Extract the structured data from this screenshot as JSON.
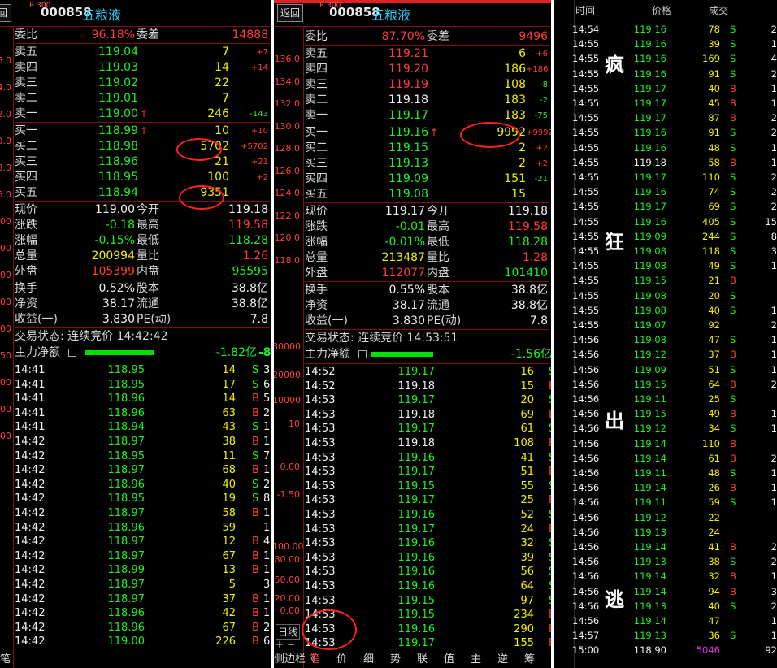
{
  "panel1": {
    "back": "回",
    "code": "000858",
    "name": "五粮液",
    "index_badge": "R 300",
    "weibi": {
      "label": "委比",
      "value": "96.18%",
      "diff_label": "委差",
      "diff": "14888"
    },
    "axis": [
      "6.0",
      "4.0",
      "2.0",
      "0.0",
      "8.0",
      "6.0",
      "00",
      "00",
      "00",
      "00",
      ".00",
      ".50",
      "00",
      "00",
      "00"
    ],
    "sell": [
      {
        "label": "卖五",
        "price": "119.04",
        "vol": "7",
        "chg": "+7"
      },
      {
        "label": "卖四",
        "price": "119.03",
        "vol": "14",
        "chg": "+14"
      },
      {
        "label": "卖三",
        "price": "119.02",
        "vol": "22",
        "chg": ""
      },
      {
        "label": "卖二",
        "price": "119.01",
        "vol": "7",
        "chg": ""
      },
      {
        "label": "卖一",
        "price": "119.00",
        "vol": "246",
        "chg": "-143",
        "arrow": "↑"
      }
    ],
    "buy": [
      {
        "label": "买一",
        "price": "118.99",
        "vol": "10",
        "chg": "+10",
        "arrow": "↑"
      },
      {
        "label": "买二",
        "price": "118.98",
        "vol": "5702",
        "chg": "+5702"
      },
      {
        "label": "买三",
        "price": "118.96",
        "vol": "21",
        "chg": "+21"
      },
      {
        "label": "买四",
        "price": "118.95",
        "vol": "100",
        "chg": "+2"
      },
      {
        "label": "买五",
        "price": "118.94",
        "vol": "9351",
        "chg": ""
      }
    ],
    "quote": [
      {
        "l": "现价",
        "v": "119.00",
        "l2": "今开",
        "v2": "119.18"
      },
      {
        "l": "涨跌",
        "v": "-0.18",
        "l2": "最高",
        "v2": "119.58"
      },
      {
        "l": "涨幅",
        "v": "-0.15%",
        "l2": "最低",
        "v2": "118.28"
      },
      {
        "l": "总量",
        "v": "200994",
        "l2": "量比",
        "v2": "1.26"
      },
      {
        "l": "外盘",
        "v": "105399",
        "l2": "内盘",
        "v2": "95595"
      }
    ],
    "fund": [
      {
        "l": "换手",
        "v": "0.52%",
        "l2": "股本",
        "v2": "38.8亿"
      },
      {
        "l": "净资",
        "v": "38.17",
        "l2": "流通",
        "v2": "38.8亿"
      },
      {
        "l": "收益(一)",
        "v": "3.830",
        "l2": "PE(动)",
        "v2": "7.8"
      }
    ],
    "status": "交易状态: 连续竞价 14:42:42",
    "main_label": "主力净额",
    "main_value": "-1.82亿",
    "main_pct": "-8%",
    "ticks": [
      {
        "t": "14:41",
        "p": "118.95",
        "v": "14",
        "d": "S",
        "n": "3"
      },
      {
        "t": "14:41",
        "p": "118.95",
        "v": "17",
        "d": "S",
        "n": "6"
      },
      {
        "t": "14:41",
        "p": "118.96",
        "v": "14",
        "d": "B",
        "n": "5"
      },
      {
        "t": "14:41",
        "p": "118.96",
        "v": "63",
        "d": "B",
        "n": "23"
      },
      {
        "t": "14:41",
        "p": "118.94",
        "v": "43",
        "d": "S",
        "n": "12"
      },
      {
        "t": "14:42",
        "p": "118.97",
        "v": "38",
        "d": "B",
        "n": "11"
      },
      {
        "t": "14:42",
        "p": "118.95",
        "v": "11",
        "d": "S",
        "n": "7"
      },
      {
        "t": "14:42",
        "p": "118.97",
        "v": "68",
        "d": "B",
        "n": "12"
      },
      {
        "t": "14:42",
        "p": "118.96",
        "v": "40",
        "d": "S",
        "n": "22"
      },
      {
        "t": "14:42",
        "p": "118.95",
        "v": "19",
        "d": "S",
        "n": "8"
      },
      {
        "t": "14:42",
        "p": "118.97",
        "v": "58",
        "d": "B",
        "n": "12"
      },
      {
        "t": "14:42",
        "p": "118.96",
        "v": "59",
        "d": "",
        "n": "15"
      },
      {
        "t": "14:42",
        "p": "118.97",
        "v": "12",
        "d": "B",
        "n": "4"
      },
      {
        "t": "14:42",
        "p": "118.97",
        "v": "67",
        "d": "B",
        "n": "14"
      },
      {
        "t": "14:42",
        "p": "118.99",
        "v": "13",
        "d": "B",
        "n": "11"
      },
      {
        "t": "14:42",
        "p": "118.97",
        "v": "5",
        "d": "",
        "n": "3"
      },
      {
        "t": "14:42",
        "p": "118.97",
        "v": "37",
        "d": "B",
        "n": "13"
      },
      {
        "t": "14:42",
        "p": "118.96",
        "v": "42",
        "d": "B",
        "n": "16"
      },
      {
        "t": "14:42",
        "p": "118.96",
        "v": "67",
        "d": "B",
        "n": "23"
      },
      {
        "t": "14:42",
        "p": "119.00",
        "v": "226",
        "d": "B",
        "n": "60"
      }
    ],
    "bottom_left": "笔"
  },
  "panel2": {
    "back": "返回",
    "code": "000858",
    "name": "五粮液",
    "index_badge": "R 300",
    "weibi": {
      "label": "委比",
      "value": "87.70%",
      "diff_label": "委差",
      "diff": "9496"
    },
    "axis": [
      "136.0",
      "134.0",
      "132.0",
      "130.0",
      "128.0",
      "126.0",
      "124.0",
      "122.0",
      "120.0",
      "118.0"
    ],
    "axis2": [
      "30000",
      "20000",
      "10000",
      "10",
      "0.00",
      "-1.50",
      "100.00",
      "80.00",
      "50.00",
      "20.00",
      "0.00"
    ],
    "side_labels": [
      "日线",
      "+",
      "−"
    ],
    "sell": [
      {
        "label": "卖五",
        "price": "119.21",
        "vol": "6",
        "chg": "+6"
      },
      {
        "label": "卖四",
        "price": "119.20",
        "vol": "186",
        "chg": "+186"
      },
      {
        "label": "卖三",
        "price": "119.19",
        "vol": "108",
        "chg": "-8"
      },
      {
        "label": "卖二",
        "price": "119.18",
        "vol": "183",
        "chg": "-2"
      },
      {
        "label": "卖一",
        "price": "119.17",
        "vol": "183",
        "chg": "-75"
      }
    ],
    "buy": [
      {
        "label": "买一",
        "price": "119.16",
        "vol": "9992",
        "chg": "+9992",
        "arrow": "↑"
      },
      {
        "label": "买二",
        "price": "119.15",
        "vol": "2",
        "chg": "+2"
      },
      {
        "label": "买三",
        "price": "119.13",
        "vol": "2",
        "chg": "+2"
      },
      {
        "label": "买四",
        "price": "119.09",
        "vol": "151",
        "chg": "-21"
      },
      {
        "label": "买五",
        "price": "119.08",
        "vol": "15",
        "chg": ""
      }
    ],
    "quote": [
      {
        "l": "现价",
        "v": "119.17",
        "l2": "今开",
        "v2": "119.18"
      },
      {
        "l": "涨跌",
        "v": "-0.01",
        "l2": "最高",
        "v2": "119.58"
      },
      {
        "l": "涨幅",
        "v": "-0.01%",
        "l2": "最低",
        "v2": "118.28"
      },
      {
        "l": "总量",
        "v": "213487",
        "l2": "量比",
        "v2": "1.28"
      },
      {
        "l": "外盘",
        "v": "112077",
        "l2": "内盘",
        "v2": "101410"
      }
    ],
    "fund": [
      {
        "l": "换手",
        "v": "0.55%",
        "l2": "股本",
        "v2": "38.8亿"
      },
      {
        "l": "净资",
        "v": "38.17",
        "l2": "流通",
        "v2": "38.8亿"
      },
      {
        "l": "收益(一)",
        "v": "3.830",
        "l2": "PE(动)",
        "v2": "7.8"
      }
    ],
    "status": "交易状态: 连续竞价 14:53:51",
    "main_label": "主力净额",
    "main_value": "-1.56亿",
    "main_pct": "-6%",
    "ticks": [
      {
        "t": "14:52",
        "p": "119.17",
        "v": "16",
        "d": "S",
        "n": "11"
      },
      {
        "t": "14:52",
        "p": "119.18",
        "v": "15",
        "d": "B",
        "n": "9"
      },
      {
        "t": "14:53",
        "p": "119.17",
        "v": "20",
        "d": "S",
        "n": "11"
      },
      {
        "t": "14:53",
        "p": "119.18",
        "v": "69",
        "d": "B",
        "n": "31"
      },
      {
        "t": "14:53",
        "p": "119.17",
        "v": "61",
        "d": "S",
        "n": "14"
      },
      {
        "t": "14:53",
        "p": "119.18",
        "v": "108",
        "d": "B",
        "n": "32"
      },
      {
        "t": "14:53",
        "p": "119.16",
        "v": "41",
        "d": "S",
        "n": "24"
      },
      {
        "t": "14:53",
        "p": "119.17",
        "v": "51",
        "d": "B",
        "n": "18"
      },
      {
        "t": "14:53",
        "p": "119.15",
        "v": "55",
        "d": "S",
        "n": "28"
      },
      {
        "t": "14:53",
        "p": "119.17",
        "v": "25",
        "d": "B",
        "n": "12"
      },
      {
        "t": "14:53",
        "p": "119.16",
        "v": "52",
        "d": "S",
        "n": "16"
      },
      {
        "t": "14:53",
        "p": "119.17",
        "v": "24",
        "d": "B",
        "n": "14"
      },
      {
        "t": "14:53",
        "p": "119.16",
        "v": "32",
        "d": "S",
        "n": "17"
      },
      {
        "t": "14:53",
        "p": "119.16",
        "v": "39",
        "d": "S",
        "n": "21"
      },
      {
        "t": "14:53",
        "p": "119.16",
        "v": "56",
        "d": "S",
        "n": "24"
      },
      {
        "t": "14:53",
        "p": "119.16",
        "v": "64",
        "d": "S",
        "n": "23"
      },
      {
        "t": "14:53",
        "p": "119.15",
        "v": "97",
        "d": "S",
        "n": "52"
      },
      {
        "t": "14:53",
        "p": "119.15",
        "v": "234",
        "d": "B",
        "n": "44"
      },
      {
        "t": "14:53",
        "p": "119.16",
        "v": "290",
        "d": "B",
        "n": "24"
      },
      {
        "t": "14:53",
        "p": "119.17",
        "v": "155",
        "d": "B",
        "n": "53"
      }
    ],
    "tabs": [
      "侧边栏《",
      "笔",
      "价",
      "细",
      "势",
      "联",
      "值",
      "主",
      "逆",
      "筹"
    ]
  },
  "panel3": {
    "headers": [
      "时间",
      "价格",
      "成交"
    ],
    "overlay": [
      "疯",
      "狂",
      "出",
      "逃"
    ],
    "ticks": [
      {
        "t": "14:54",
        "p": "119.16",
        "v": "78",
        "d": "S",
        "n": "2"
      },
      {
        "t": "14:55",
        "p": "119.16",
        "v": "39",
        "d": "S",
        "n": "1"
      },
      {
        "t": "14:55",
        "p": "119.16",
        "v": "169",
        "d": "S",
        "n": "4"
      },
      {
        "t": "14:55",
        "p": "119.16",
        "v": "91",
        "d": "S",
        "n": "2"
      },
      {
        "t": "14:55",
        "p": "119.17",
        "v": "40",
        "d": "B",
        "n": "1"
      },
      {
        "t": "14:55",
        "p": "119.17",
        "v": "45",
        "d": "B",
        "n": "1"
      },
      {
        "t": "14:55",
        "p": "119.17",
        "v": "87",
        "d": "B",
        "n": "2"
      },
      {
        "t": "14:55",
        "p": "119.16",
        "v": "91",
        "d": "S",
        "n": "2"
      },
      {
        "t": "14:55",
        "p": "119.16",
        "v": "48",
        "d": "S",
        "n": "1"
      },
      {
        "t": "14:55",
        "p": "119.18",
        "v": "58",
        "d": "B",
        "n": "1"
      },
      {
        "t": "14:55",
        "p": "119.17",
        "v": "110",
        "d": "S",
        "n": "2"
      },
      {
        "t": "14:55",
        "p": "119.16",
        "v": "74",
        "d": "S",
        "n": "2"
      },
      {
        "t": "14:55",
        "p": "119.17",
        "v": "69",
        "d": "S",
        "n": "2"
      },
      {
        "t": "14:55",
        "p": "119.16",
        "v": "405",
        "d": "S",
        "n": "15"
      },
      {
        "t": "14:55",
        "p": "119.09",
        "v": "244",
        "d": "S",
        "n": "8"
      },
      {
        "t": "14:55",
        "p": "119.08",
        "v": "118",
        "d": "S",
        "n": "3"
      },
      {
        "t": "14:55",
        "p": "119.08",
        "v": "49",
        "d": "S",
        "n": "1"
      },
      {
        "t": "14:55",
        "p": "119.15",
        "v": "21",
        "d": "B",
        "n": ""
      },
      {
        "t": "14:55",
        "p": "119.08",
        "v": "20",
        "d": "S",
        "n": ""
      },
      {
        "t": "14:55",
        "p": "119.08",
        "v": "40",
        "d": "S",
        "n": "1"
      },
      {
        "t": "14:55",
        "p": "119.07",
        "v": "92",
        "d": "",
        "n": "2"
      },
      {
        "t": "14:56",
        "p": "119.08",
        "v": "47",
        "d": "S",
        "n": "1"
      },
      {
        "t": "14:56",
        "p": "119.12",
        "v": "37",
        "d": "B",
        "n": "1"
      },
      {
        "t": "14:56",
        "p": "119.09",
        "v": "51",
        "d": "S",
        "n": "1"
      },
      {
        "t": "14:56",
        "p": "119.15",
        "v": "64",
        "d": "B",
        "n": "2"
      },
      {
        "t": "14:56",
        "p": "119.11",
        "v": "25",
        "d": "S",
        "n": ""
      },
      {
        "t": "14:56",
        "p": "119.15",
        "v": "49",
        "d": "B",
        "n": "1"
      },
      {
        "t": "14:56",
        "p": "119.12",
        "v": "34",
        "d": "S",
        "n": "1"
      },
      {
        "t": "14:56",
        "p": "119.14",
        "v": "110",
        "d": "B",
        "n": ""
      },
      {
        "t": "14:56",
        "p": "119.14",
        "v": "61",
        "d": "B",
        "n": "2"
      },
      {
        "t": "14:56",
        "p": "119.11",
        "v": "48",
        "d": "S",
        "n": "1"
      },
      {
        "t": "14:56",
        "p": "119.14",
        "v": "26",
        "d": "B",
        "n": "1"
      },
      {
        "t": "14:56",
        "p": "119.11",
        "v": "59",
        "d": "S",
        "n": "1"
      },
      {
        "t": "14:56",
        "p": "119.12",
        "v": "22",
        "d": "",
        "n": ""
      },
      {
        "t": "14:56",
        "p": "119.13",
        "v": "24",
        "d": "",
        "n": ""
      },
      {
        "t": "14:56",
        "p": "119.14",
        "v": "41",
        "d": "B",
        "n": "2"
      },
      {
        "t": "14:56",
        "p": "119.13",
        "v": "38",
        "d": "S",
        "n": "2"
      },
      {
        "t": "14:56",
        "p": "119.14",
        "v": "32",
        "d": "B",
        "n": "1"
      },
      {
        "t": "14:56",
        "p": "119.14",
        "v": "94",
        "d": "B",
        "n": "3"
      },
      {
        "t": "14:56",
        "p": "119.13",
        "v": "40",
        "d": "S",
        "n": "2"
      },
      {
        "t": "14:56",
        "p": "119.14",
        "v": "47",
        "d": "",
        "n": "1"
      },
      {
        "t": "14:57",
        "p": "119.13",
        "v": "36",
        "d": "S",
        "n": "1"
      },
      {
        "t": "15:00",
        "p": "118.90",
        "v": "5046",
        "d": "",
        "n": "92"
      }
    ]
  }
}
